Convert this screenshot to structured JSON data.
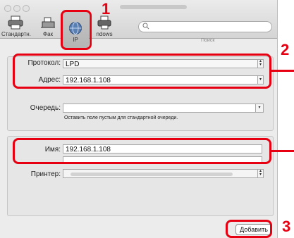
{
  "toolbar": {
    "items": [
      {
        "label": "Стандартн.",
        "icon": "printer-icon"
      },
      {
        "label": "Фак",
        "icon": "fax-icon"
      },
      {
        "label": "IP",
        "icon": "globe-icon"
      },
      {
        "label": "ndows",
        "icon": "windows-printer-icon"
      }
    ],
    "search_placeholder": "Поиск"
  },
  "form": {
    "protocol_label": "Протокол:",
    "protocol_value": "LPD",
    "address_label": "Адрес:",
    "address_value": "192.168.1.108",
    "queue_label": "Очередь:",
    "queue_value": "",
    "queue_hint": "Оставить поле пустым для стандартной очереди.",
    "name_label": "Имя:",
    "name_value": "192.168.1.108",
    "printer_label": "Принтер:"
  },
  "buttons": {
    "add_label": "Добавить"
  },
  "callouts": {
    "one": "1",
    "two": "2",
    "three": "3"
  },
  "colors": {
    "callout": "#e60012"
  }
}
